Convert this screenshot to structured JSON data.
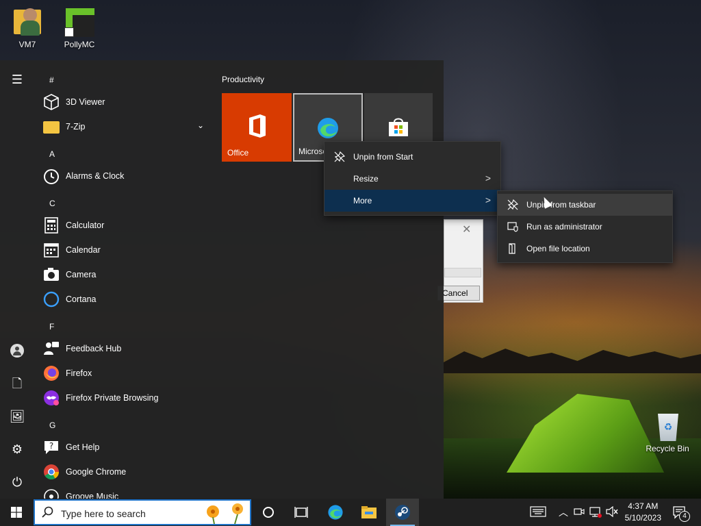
{
  "desktop": {
    "icons": [
      {
        "label": "VM7",
        "icon": "folder-user-icon"
      },
      {
        "label": "PollyMC",
        "icon": "pollymc-icon"
      },
      {
        "label": "Recycle Bin",
        "icon": "recycle-bin-icon"
      }
    ]
  },
  "start_menu": {
    "letters": [
      "#",
      "A",
      "C",
      "F",
      "G"
    ],
    "apps": [
      {
        "name": "3D Viewer",
        "icon": "cube-icon"
      },
      {
        "name": "7-Zip",
        "icon": "folder-icon"
      },
      {
        "name": "Alarms & Clock",
        "icon": "clock-icon"
      },
      {
        "name": "Calculator",
        "icon": "calculator-icon"
      },
      {
        "name": "Calendar",
        "icon": "calendar-icon"
      },
      {
        "name": "Camera",
        "icon": "camera-icon"
      },
      {
        "name": "Cortana",
        "icon": "cortana-icon"
      },
      {
        "name": "Feedback Hub",
        "icon": "feedback-icon"
      },
      {
        "name": "Firefox",
        "icon": "firefox-icon"
      },
      {
        "name": "Firefox Private Browsing",
        "icon": "firefox-private-icon"
      },
      {
        "name": "Get Help",
        "icon": "help-icon"
      },
      {
        "name": "Google Chrome",
        "icon": "chrome-icon"
      },
      {
        "name": "Groove Music",
        "icon": "music-icon"
      }
    ],
    "group_title": "Productivity",
    "tiles": [
      {
        "label": "Office",
        "color": "#d83b01"
      },
      {
        "label": "Microso",
        "color": "#3a3a3a"
      },
      {
        "label": "",
        "color": "#3a3a3a"
      }
    ]
  },
  "context_menu": {
    "items": [
      "Unpin from Start",
      "Resize",
      "More"
    ],
    "submenu": [
      "Unpin from taskbar",
      "Run as administrator",
      "Open file location"
    ]
  },
  "dialog": {
    "cancel_label": "Cancel"
  },
  "taskbar": {
    "search_placeholder": "Type here to search",
    "time": "4:37 AM",
    "date": "5/10/2023",
    "notification_count": "4"
  },
  "colors": {
    "accent": "#0078d7",
    "office": "#d83b01",
    "menu_highlight": "#0d2f4f"
  }
}
